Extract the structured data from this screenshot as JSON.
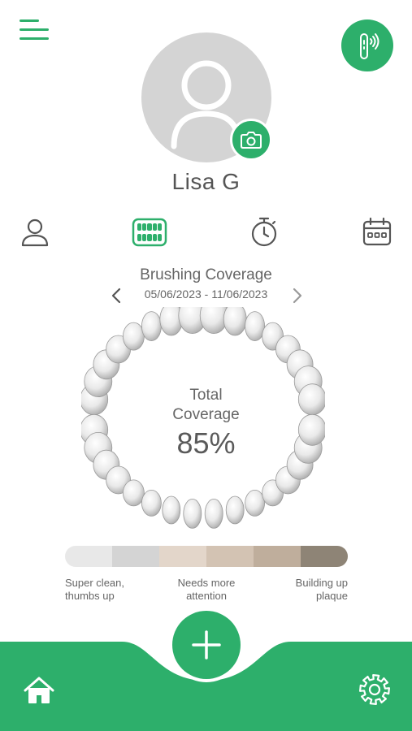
{
  "header": {
    "menu_icon": "hamburger-menu-icon",
    "toothbrush_icon": "toothbrush-connection-icon"
  },
  "profile": {
    "name": "Lisa G",
    "camera_icon": "camera-icon"
  },
  "tabs": [
    {
      "icon": "profile-icon"
    },
    {
      "icon": "teeth-icon",
      "active": true
    },
    {
      "icon": "stopwatch-icon"
    },
    {
      "icon": "calendar-icon"
    }
  ],
  "coverage": {
    "title": "Brushing Coverage",
    "date_range": "05/06/2023 - 11/06/2023",
    "total_label_line1": "Total",
    "total_label_line2": "Coverage",
    "total_value": "85%",
    "coverage_percent": 85
  },
  "legend": {
    "colors": [
      "#e8e8e8",
      "#d4d4d4",
      "#e3d6ca",
      "#d3c3b3",
      "#bfae9c",
      "#8e8476"
    ],
    "labels": [
      {
        "line1": "Super clean,",
        "line2": "thumbs up"
      },
      {
        "line1": "Needs more",
        "line2": "attention"
      },
      {
        "line1": "Building up",
        "line2": "plaque"
      }
    ]
  },
  "colors": {
    "accent": "#2daf6b"
  }
}
